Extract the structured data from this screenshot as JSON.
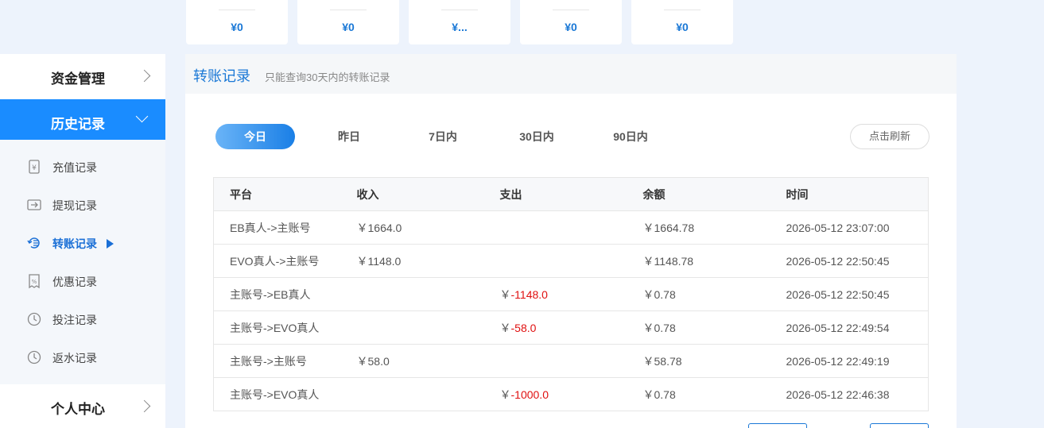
{
  "balances": [
    "¥0",
    "¥0",
    "¥...",
    "¥0",
    "¥0"
  ],
  "sidebar": {
    "funds": "资金管理",
    "history": "历史记录",
    "personal": "个人中心",
    "items": [
      {
        "label": "充值记录",
        "icon": "deposit-icon"
      },
      {
        "label": "提现记录",
        "icon": "withdraw-icon"
      },
      {
        "label": "转账记录",
        "icon": "transfer-icon"
      },
      {
        "label": "优惠记录",
        "icon": "promo-icon"
      },
      {
        "label": "投注记录",
        "icon": "bet-clock-icon"
      },
      {
        "label": "返水记录",
        "icon": "rebate-clock-icon"
      }
    ]
  },
  "main": {
    "title": "转账记录",
    "note": "只能查询30天内的转账记录",
    "tabs": [
      "今日",
      "昨日",
      "7日内",
      "30日内",
      "90日内"
    ],
    "refresh": "点击刷新"
  },
  "table": {
    "headers": [
      "平台",
      "收入",
      "支出",
      "余额",
      "时间"
    ],
    "rows": [
      [
        "EB真人->主账号",
        "￥1664.0",
        "",
        "￥1664.78",
        "2026-05-12 23:07:00"
      ],
      [
        "EVO真人->主账号",
        "￥1148.0",
        "",
        "￥1148.78",
        "2026-05-12 22:50:45"
      ],
      [
        "主账号->EB真人",
        "",
        "-1148.0",
        "￥0.78",
        "2026-05-12 22:50:45"
      ],
      [
        "主账号->EVO真人",
        "",
        "-58.0",
        "￥0.78",
        "2026-05-12 22:49:54"
      ],
      [
        "主账号->主账号",
        "￥58.0",
        "",
        "￥58.78",
        "2026-05-12 22:49:19"
      ],
      [
        "主账号->EVO真人",
        "",
        "-1000.0",
        "￥0.78",
        "2026-05-12 22:46:38"
      ]
    ],
    "currency": "￥"
  },
  "colors": {
    "accent": "#1a8cff",
    "negative": "#e01010",
    "brand_text": "#1a78d6"
  }
}
